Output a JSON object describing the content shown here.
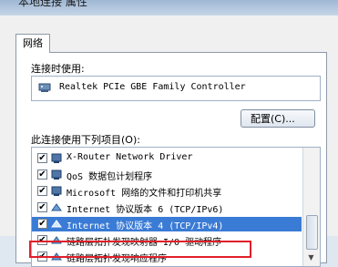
{
  "window": {
    "title": "本地连接 属性"
  },
  "tabs": [
    {
      "label": "网络"
    }
  ],
  "connection": {
    "label": "连接时使用:",
    "adapter": "Realtek PCIe GBE Family Controller",
    "config_button": "配置(C)..."
  },
  "items": {
    "label": "此连接使用下列项目(O):",
    "list": [
      {
        "text": "X-Router Network Driver",
        "checked": true,
        "icon": "network-client-icon"
      },
      {
        "text": "QoS 数据包计划程序",
        "checked": true,
        "icon": "network-client-icon"
      },
      {
        "text": "Microsoft 网络的文件和打印机共享",
        "checked": true,
        "icon": "network-client-icon"
      },
      {
        "text": "Internet 协议版本 6 (TCP/IPv6)",
        "checked": true,
        "icon": "protocol-icon"
      },
      {
        "text": "Internet 协议版本 4 (TCP/IPv4)",
        "checked": true,
        "icon": "protocol-icon",
        "selected": true
      },
      {
        "text": "链路层拓扑发现映射器 I/O 驱动程序",
        "checked": true,
        "icon": "protocol-icon"
      },
      {
        "text": "链路层拓扑发现响应程序",
        "checked": true,
        "icon": "protocol-icon"
      }
    ]
  }
}
